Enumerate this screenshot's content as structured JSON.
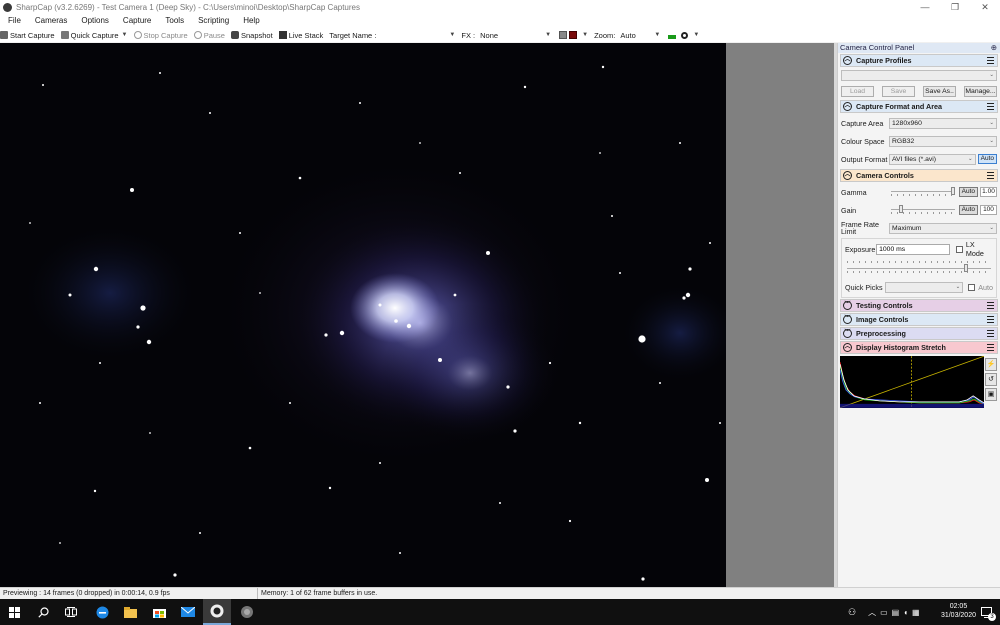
{
  "window": {
    "title": "SharpCap (v3.2.6269) - Test Camera 1 (Deep Sky) - C:\\Users\\minoi\\Desktop\\SharpCap Captures",
    "minimize_glyph": "—",
    "maximize_glyph": "❐",
    "close_glyph": "✕"
  },
  "menu": [
    "File",
    "Cameras",
    "Options",
    "Capture",
    "Tools",
    "Scripting",
    "Help"
  ],
  "toolbar": {
    "start_capture": "Start Capture",
    "quick_capture": "Quick Capture",
    "stop_capture": "Stop Capture",
    "pause": "Pause",
    "snapshot": "Snapshot",
    "live_stack": "Live Stack",
    "target_name_label": "Target Name :",
    "target_name_value": "",
    "fx_label": "FX :",
    "fx_value": "None",
    "zoom_label": "Zoom:",
    "zoom_value": "Auto"
  },
  "panel": {
    "title": "Camera Control Panel",
    "pin_glyph": "⊕",
    "capture_profiles": {
      "header": "Capture Profiles",
      "selected": "",
      "load": "Load",
      "save": "Save",
      "save_as": "Save As..",
      "manage": "Manage..."
    },
    "format": {
      "header": "Capture Format and Area",
      "capture_area_label": "Capture Area",
      "capture_area_value": "1280x960",
      "colour_space_label": "Colour Space",
      "colour_space_value": "RGB32",
      "output_format_label": "Output Format",
      "output_format_value": "AVI files (*.avi)",
      "output_auto": "Auto"
    },
    "camera_controls": {
      "header": "Camera Controls",
      "gamma_label": "Gamma",
      "gamma_auto": "Auto",
      "gamma_value": "1.00",
      "gamma_level": 0.95,
      "gain_label": "Gain",
      "gain_auto": "Auto",
      "gain_value": "100",
      "gain_level": 0.18,
      "frame_rate_label": "Frame Rate Limit",
      "frame_rate_value": "Maximum",
      "exposure_label": "Exposure",
      "exposure_value": "1000 ms",
      "lx_mode": "LX Mode",
      "exposure_level": 0.82,
      "quick_picks_label": "Quick Picks",
      "quick_picks_value": "",
      "quick_picks_auto": "Auto"
    },
    "testing_controls": {
      "header": "Testing Controls"
    },
    "image_controls": {
      "header": "Image Controls"
    },
    "preprocessing": {
      "header": "Preprocessing"
    },
    "histogram": {
      "header": "Display Histogram Stretch"
    }
  },
  "status": {
    "left": "Previewing : 14 frames (0 dropped) in 0:00:14, 0.9 fps",
    "right": "Memory: 1 of 62 frame buffers in use."
  },
  "taskbar": {
    "time": "02:05",
    "date": "31/03/2020"
  },
  "colors": {
    "capture_profiles_header": "#dce8f5",
    "format_header": "#dce8f5",
    "camera_controls_header": "#fbe6cc",
    "testing_header": "#e6cfe6",
    "image_controls_header": "#dce8f5",
    "preprocessing_header": "#dcdcf2",
    "histogram_header": "#f8c8cf"
  }
}
